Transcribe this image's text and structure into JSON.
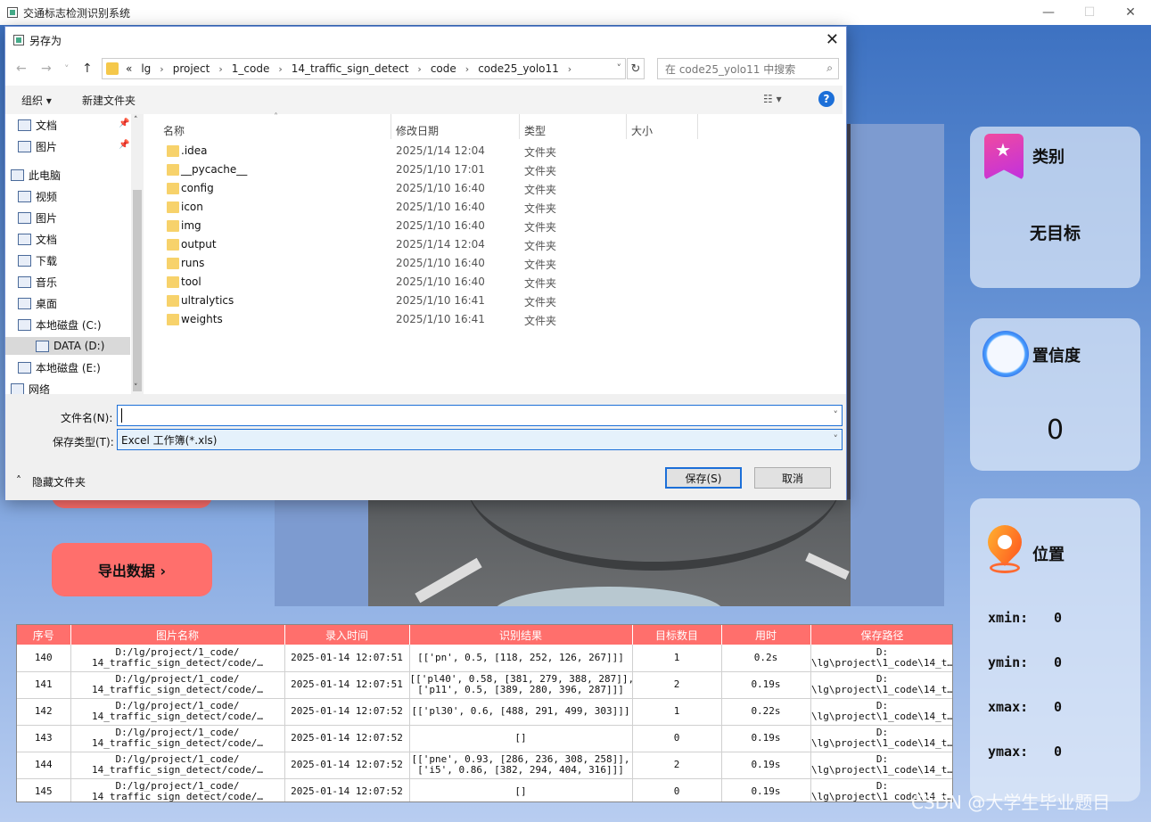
{
  "app": {
    "title": "交通标志检测识别系统",
    "win_min": "—",
    "win_max": "☐",
    "win_close": "✕"
  },
  "panels": {
    "category": {
      "title": "类别",
      "value": "无目标"
    },
    "confidence": {
      "title": "置信度",
      "value": "0"
    },
    "position": {
      "title": "位置",
      "xmin_label": "xmin:",
      "xmin": "0",
      "ymin_label": "ymin:",
      "ymin": "0",
      "xmax_label": "xmax:",
      "xmax": "0",
      "ymax_label": "ymax:",
      "ymax": "0"
    }
  },
  "buttons": {
    "export": "导出数据 ›"
  },
  "table": {
    "headers": [
      "序号",
      "图片名称",
      "录入时间",
      "识别结果",
      "目标数目",
      "用时",
      "保存路径"
    ],
    "rows": [
      [
        "140",
        "D:/lg/project/1_code/\n14_traffic_sign_detect/code/…",
        "2025-01-14 12:07:51",
        "[['pn', 0.5, [118, 252, 126, 267]]]",
        "1",
        "0.2s",
        "D:\n\\lg\\project\\1_code\\14_t…"
      ],
      [
        "141",
        "D:/lg/project/1_code/\n14_traffic_sign_detect/code/…",
        "2025-01-14 12:07:51",
        "[['pl40', 0.58, [381, 279, 388, 287]],\n['p11', 0.5, [389, 280, 396, 287]]]",
        "2",
        "0.19s",
        "D:\n\\lg\\project\\1_code\\14_t…"
      ],
      [
        "142",
        "D:/lg/project/1_code/\n14_traffic_sign_detect/code/…",
        "2025-01-14 12:07:52",
        "[['pl30', 0.6, [488, 291, 499, 303]]]",
        "1",
        "0.22s",
        "D:\n\\lg\\project\\1_code\\14_t…"
      ],
      [
        "143",
        "D:/lg/project/1_code/\n14_traffic_sign_detect/code/…",
        "2025-01-14 12:07:52",
        "[]",
        "0",
        "0.19s",
        "D:\n\\lg\\project\\1_code\\14_t…"
      ],
      [
        "144",
        "D:/lg/project/1_code/\n14_traffic_sign_detect/code/…",
        "2025-01-14 12:07:52",
        "[['pne', 0.93, [286, 236, 308, 258]],\n['i5', 0.86, [382, 294, 404, 316]]]",
        "2",
        "0.19s",
        "D:\n\\lg\\project\\1_code\\14_t…"
      ],
      [
        "145",
        "D:/lg/project/1_code/\n14_traffic_sign_detect/code/…",
        "2025-01-14 12:07:52",
        "[]",
        "0",
        "0.19s",
        "D:\n\\lg\\project\\1_code\\14_t…"
      ]
    ]
  },
  "dialog": {
    "title": "另存为",
    "close": "✕",
    "nav_back": "←",
    "nav_forward": "→",
    "nav_dropdown": "˅",
    "nav_up": "↑",
    "breadcrumbs": [
      "«",
      "lg",
      "project",
      "1_code",
      "14_traffic_sign_detect",
      "code",
      "code25_yolo11"
    ],
    "search_placeholder": "在 code25_yolo11 中搜索",
    "toolbar": {
      "organize": "组织 ▾",
      "new_folder": "新建文件夹",
      "view": "☷ ▾",
      "help": "?"
    },
    "nav_items": [
      {
        "label": "文档",
        "pinned": true
      },
      {
        "label": "图片",
        "pinned": true
      },
      {
        "label": "此电脑"
      },
      {
        "label": "视频"
      },
      {
        "label": "图片"
      },
      {
        "label": "文档"
      },
      {
        "label": "下载"
      },
      {
        "label": "音乐"
      },
      {
        "label": "桌面"
      },
      {
        "label": "本地磁盘 (C:)"
      },
      {
        "label": "DATA (D:)",
        "selected": true
      },
      {
        "label": "本地磁盘 (E:)"
      },
      {
        "label": "网络"
      }
    ],
    "columns": [
      "名称",
      "修改日期",
      "类型",
      "大小"
    ],
    "files": [
      {
        "name": ".idea",
        "date": "2025/1/14 12:04",
        "type": "文件夹"
      },
      {
        "name": "__pycache__",
        "date": "2025/1/10 17:01",
        "type": "文件夹"
      },
      {
        "name": "config",
        "date": "2025/1/10 16:40",
        "type": "文件夹"
      },
      {
        "name": "icon",
        "date": "2025/1/10 16:40",
        "type": "文件夹"
      },
      {
        "name": "img",
        "date": "2025/1/10 16:40",
        "type": "文件夹"
      },
      {
        "name": "output",
        "date": "2025/1/14 12:04",
        "type": "文件夹"
      },
      {
        "name": "runs",
        "date": "2025/1/10 16:40",
        "type": "文件夹"
      },
      {
        "name": "tool",
        "date": "2025/1/10 16:40",
        "type": "文件夹"
      },
      {
        "name": "ultralytics",
        "date": "2025/1/10 16:41",
        "type": "文件夹"
      },
      {
        "name": "weights",
        "date": "2025/1/10 16:41",
        "type": "文件夹"
      }
    ],
    "filename_label": "文件名(N):",
    "filename_value": "",
    "filetype_label": "保存类型(T):",
    "filetype_value": "Excel 工作簿(*.xls)",
    "hide_folders": "隐藏文件夹",
    "save": "保存(S)",
    "cancel": "取消"
  },
  "watermark": "CSDN @大学生毕业题目"
}
